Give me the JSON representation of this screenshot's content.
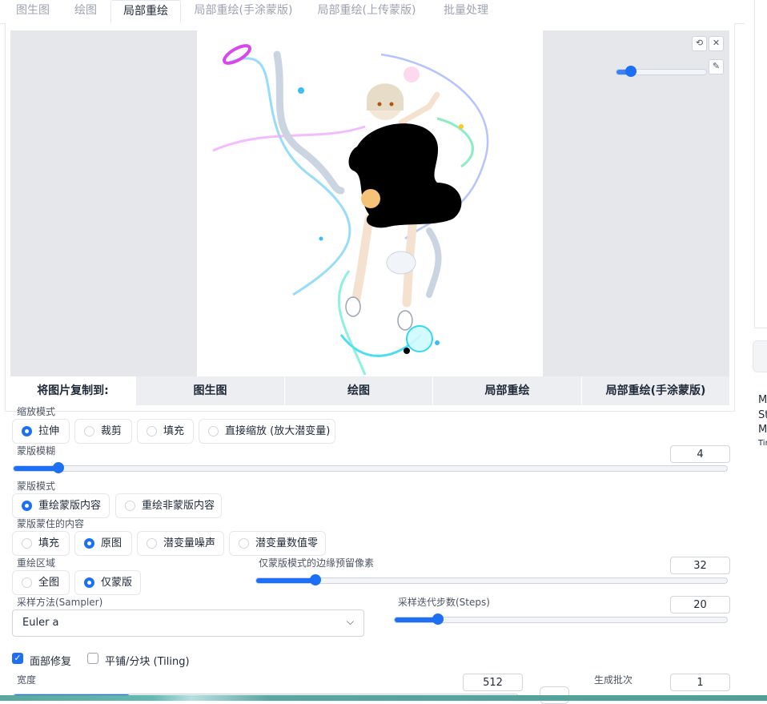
{
  "tabs": [
    {
      "label": "图生图",
      "active": false
    },
    {
      "label": "绘图",
      "active": false
    },
    {
      "label": "局部重绘",
      "active": true
    },
    {
      "label": "局部重绘(手涂蒙版)",
      "active": false
    },
    {
      "label": "局部重绘(上传蒙版)",
      "active": false
    },
    {
      "label": "批量处理",
      "active": false
    }
  ],
  "editor": {
    "undo_icon": "undo-icon",
    "close_icon": "close-icon",
    "brush_icon": "brush-icon",
    "brush_size_fraction": 0.16
  },
  "copy_to": {
    "label": "将图片复制到:",
    "buttons": [
      "图生图",
      "绘图",
      "局部重绘",
      "局部重绘(手涂蒙版)"
    ]
  },
  "resize_mode": {
    "label": "缩放模式",
    "options": [
      "拉伸",
      "裁剪",
      "填充",
      "直接缩放 (放大潜变量)"
    ],
    "selected": "拉伸"
  },
  "mask_blur": {
    "label": "蒙版模糊",
    "value": "4",
    "fraction": 0.063
  },
  "mask_mode": {
    "label": "蒙版模式",
    "options": [
      "重绘蒙版内容",
      "重绘非蒙版内容"
    ],
    "selected": "重绘蒙版内容"
  },
  "masked_content": {
    "label": "蒙版蒙住的内容",
    "options": [
      "填充",
      "原图",
      "潜变量噪声",
      "潜变量数值零"
    ],
    "selected": "原图"
  },
  "inpaint_area": {
    "label": "重绘区域",
    "options": [
      "全图",
      "仅蒙版"
    ],
    "selected": "仅蒙版"
  },
  "only_masked_padding": {
    "label": "仅蒙版模式的边缘预留像素",
    "value": "32",
    "fraction": 0.125
  },
  "sampler": {
    "label": "采样方法(Sampler)",
    "value": "Euler a"
  },
  "steps": {
    "label": "采样迭代步数(Steps)",
    "value": "20",
    "fraction": 0.13
  },
  "restore_faces": {
    "label": "面部修复",
    "checked": true
  },
  "tiling": {
    "label": "平铺/分块 (Tiling)",
    "checked": false
  },
  "width": {
    "label": "宽度",
    "value": "512"
  },
  "batch_count": {
    "label": "生成批次",
    "value": "1"
  },
  "right_panel": {
    "lines": [
      "M",
      "St",
      "M",
      "Tir"
    ]
  },
  "colors": {
    "accent": "#1d6ff3",
    "mask": "#000000"
  }
}
